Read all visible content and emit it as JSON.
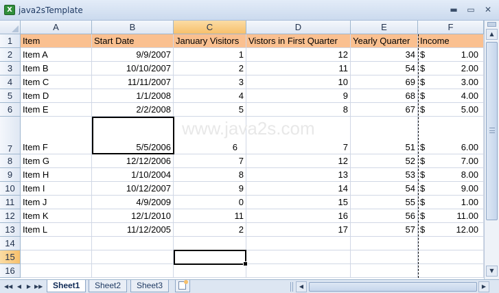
{
  "window": {
    "title": "java2sTemplate",
    "app_icon": "excel-icon",
    "minimize": "▬",
    "maximize": "▭",
    "close": "✕"
  },
  "columns": [
    "A",
    "B",
    "C",
    "D",
    "E",
    "F"
  ],
  "selected_column": "C",
  "selected_row": "15",
  "row_numbers": [
    "1",
    "2",
    "3",
    "4",
    "5",
    "6",
    "7",
    "8",
    "9",
    "10",
    "11",
    "12",
    "13",
    "14",
    "15",
    "16"
  ],
  "header_row": [
    "Item",
    "Start Date",
    "January Visitors",
    "Vistors in First Quarter",
    "Yearly Quarter",
    "Income"
  ],
  "rows": [
    {
      "item": "Item A",
      "date": "9/9/2007",
      "jan": "1",
      "q1": "12",
      "yearly": "34",
      "cur": "$",
      "income": "1.00"
    },
    {
      "item": "Item B",
      "date": "10/10/2007",
      "jan": "2",
      "q1": "11",
      "yearly": "54",
      "cur": "$",
      "income": "2.00"
    },
    {
      "item": "Item C",
      "date": "11/11/2007",
      "jan": "3",
      "q1": "10",
      "yearly": "69",
      "cur": "$",
      "income": "3.00"
    },
    {
      "item": "Item D",
      "date": "1/1/2008",
      "jan": "4",
      "q1": "9",
      "yearly": "68",
      "cur": "$",
      "income": "4.00"
    },
    {
      "item": "Item E",
      "date": "2/2/2008",
      "jan": "5",
      "q1": "8",
      "yearly": "67",
      "cur": "$",
      "income": "5.00"
    },
    {
      "item": "Item F",
      "date": "5/5/2006",
      "jan": "6",
      "q1": "7",
      "yearly": "51",
      "cur": "$",
      "income": "6.00"
    },
    {
      "item": "Item G",
      "date": "12/12/2006",
      "jan": "7",
      "q1": "12",
      "yearly": "52",
      "cur": "$",
      "income": "7.00"
    },
    {
      "item": "Item H",
      "date": "1/10/2004",
      "jan": "8",
      "q1": "13",
      "yearly": "53",
      "cur": "$",
      "income": "8.00"
    },
    {
      "item": "Item I",
      "date": "10/12/2007",
      "jan": "9",
      "q1": "14",
      "yearly": "54",
      "cur": "$",
      "income": "9.00"
    },
    {
      "item": "Item J",
      "date": "4/9/2009",
      "jan": "0",
      "q1": "15",
      "yearly": "55",
      "cur": "$",
      "income": "1.00"
    },
    {
      "item": "Item K",
      "date": "12/1/2010",
      "jan": "11",
      "q1": "16",
      "yearly": "56",
      "cur": "$",
      "income": "11.00"
    },
    {
      "item": "Item L",
      "date": "11/12/2005",
      "jan": "2",
      "q1": "17",
      "yearly": "57",
      "cur": "$",
      "income": "12.00"
    }
  ],
  "watermark": "www.java2s.com",
  "sheets": [
    {
      "label": "Sheet1",
      "active": true
    },
    {
      "label": "Sheet2",
      "active": false
    },
    {
      "label": "Sheet3",
      "active": false
    }
  ],
  "nav": {
    "first": "◀◀",
    "prev": "◀",
    "next": "▶",
    "last": "▶▶"
  },
  "scroll": {
    "up": "▲",
    "down": "▼",
    "left": "◀",
    "right": "▶"
  },
  "colors": {
    "header_fill": "#fac090",
    "selected_header": "#f7c06b",
    "gridline": "#d0d7e5"
  }
}
